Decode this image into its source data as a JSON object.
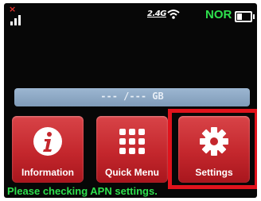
{
  "status_bar": {
    "wifi_band": "2.4G",
    "mode": "NOR",
    "battery_level": 0.4,
    "icons": [
      "signal-x-icon",
      "signal-bars-icon",
      "wifi-icon",
      "battery-icon"
    ]
  },
  "data_usage": {
    "text": "--- /--- GB"
  },
  "tiles": [
    {
      "label": "Information",
      "icon": "info-icon"
    },
    {
      "label": "Quick Menu",
      "icon": "grid-icon"
    },
    {
      "label": "Settings",
      "icon": "gear-icon"
    }
  ],
  "message": "Please checking APN settings.",
  "colors": {
    "tile_red": "#c4272d",
    "highlight_red": "#e0131c",
    "status_green": "#2ee04d",
    "bar_blue": "#8ea9c5"
  }
}
